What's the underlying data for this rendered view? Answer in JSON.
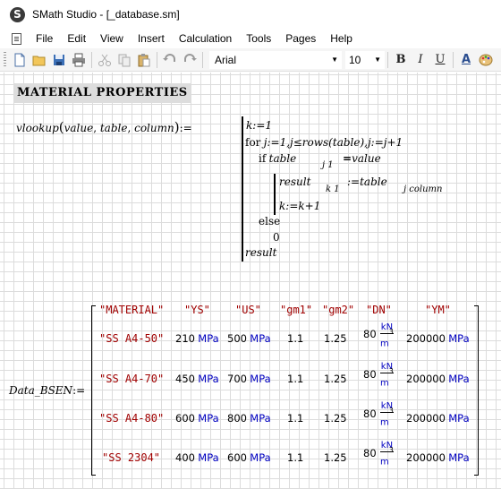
{
  "window": {
    "title": "SMath Studio - [_database.sm]",
    "app_icon": "smath-logo"
  },
  "menu": [
    "File",
    "Edit",
    "View",
    "Insert",
    "Calculation",
    "Tools",
    "Pages",
    "Help"
  ],
  "toolbar": {
    "buttons": [
      "new-document-icon",
      "open-folder-icon",
      "save-icon",
      "print-icon",
      "cut-icon",
      "copy-icon",
      "paste-icon",
      "undo-icon",
      "redo-icon"
    ],
    "font": "Arial",
    "size": "10",
    "bold": "B",
    "italic": "I",
    "underline": "U",
    "text_color_glyph": "A"
  },
  "sheet": {
    "heading": "MATERIAL PROPERTIES",
    "func": {
      "name": "vlookup",
      "args": [
        "value",
        "table",
        "column"
      ],
      "lines": {
        "k_init": "k:=1",
        "for_kw": "for",
        "for_rest": "j:=1,j≤rows(table),j:=j+1",
        "if_kw": "if",
        "table": "table",
        "sub_j1": "j 1",
        "eq_value": "value",
        "result": "result",
        "sub_k1": "k 1",
        "assign_table": ":=table",
        "sub_jcol": "j column",
        "k_inc": "k:=k+1",
        "else_kw": "else",
        "zero": "0",
        "ret": "result"
      }
    },
    "data": {
      "name": "Data_BSEN",
      "headers": [
        "\"MATERIAL\"",
        "\"YS\"",
        "\"US\"",
        "\"gm1\"",
        "\"gm2\"",
        "\"DN\"",
        "\"YM\""
      ],
      "rows": [
        {
          "material": "\"SS A4-50\"",
          "ys": "210",
          "ys_unit": "MPa",
          "us": "500",
          "us_unit": "MPa",
          "gm1": "1.1",
          "gm2": "1.25",
          "dn": "80",
          "dn_unit_num": "kN",
          "dn_unit_den": "m",
          "dn_unit_exp": "3",
          "ym": "200000",
          "ym_unit": "MPa"
        },
        {
          "material": "\"SS A4-70\"",
          "ys": "450",
          "ys_unit": "MPa",
          "us": "700",
          "us_unit": "MPa",
          "gm1": "1.1",
          "gm2": "1.25",
          "dn": "80",
          "dn_unit_num": "kN",
          "dn_unit_den": "m",
          "dn_unit_exp": "3",
          "ym": "200000",
          "ym_unit": "MPa"
        },
        {
          "material": "\"SS A4-80\"",
          "ys": "600",
          "ys_unit": "MPa",
          "us": "800",
          "us_unit": "MPa",
          "gm1": "1.1",
          "gm2": "1.25",
          "dn": "80",
          "dn_unit_num": "kN",
          "dn_unit_den": "m",
          "dn_unit_exp": "3",
          "ym": "200000",
          "ym_unit": "MPa"
        },
        {
          "material": "\"SS 2304\"",
          "ys": "400",
          "ys_unit": "MPa",
          "us": "600",
          "us_unit": "MPa",
          "gm1": "1.1",
          "gm2": "1.25",
          "dn": "80",
          "dn_unit_num": "kN",
          "dn_unit_den": "m",
          "dn_unit_exp": "3",
          "ym": "200000",
          "ym_unit": "MPa"
        }
      ]
    }
  },
  "colors": {
    "string": "#a00000",
    "unit": "#0000c0",
    "heading_bg": "#dddddd",
    "grid": "#dcdcdc"
  }
}
